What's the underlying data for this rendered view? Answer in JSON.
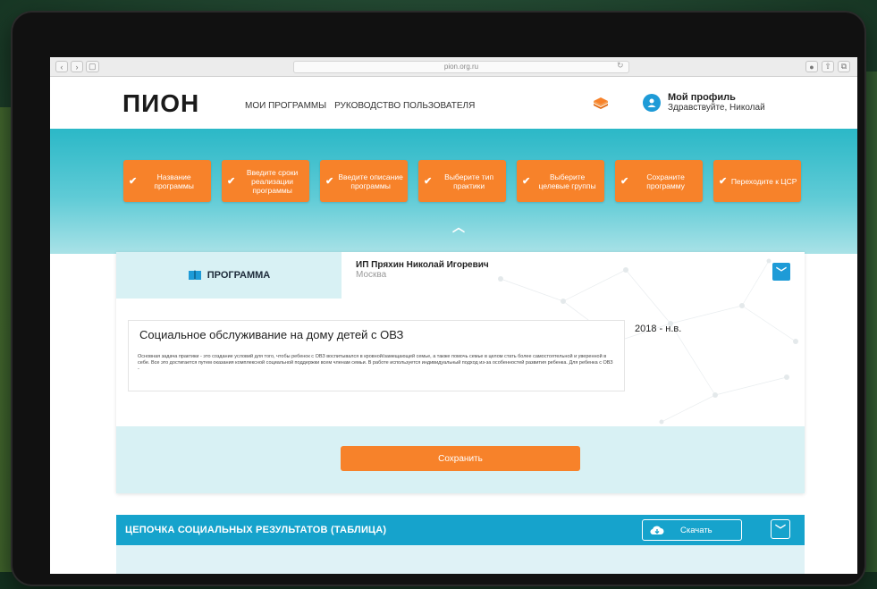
{
  "browser": {
    "url": "pion.org.ru",
    "nav_back": "‹",
    "nav_forward": "›",
    "sidebar_btn": "▢",
    "reload": "↻"
  },
  "header": {
    "logo": "ПИОН",
    "nav": [
      "МОИ ПРОГРАММЫ",
      "РУКОВОДСТВО ПОЛЬЗОВАТЕЛЯ"
    ],
    "profile_title": "Мой профиль",
    "profile_greeting": "Здравствуйте, Николай"
  },
  "steps": [
    {
      "label": "Название программы"
    },
    {
      "label": "Введите сроки реализации программы"
    },
    {
      "label": "Введите описание программы"
    },
    {
      "label": "Выберите тип практики"
    },
    {
      "label": "Выберите целевые группы"
    },
    {
      "label": "Сохраните программу"
    },
    {
      "label": "Переходите к ЦСР"
    }
  ],
  "program": {
    "tab_title": "ПРОГРАММА",
    "owner_name": "ИП Пряхин Николай Игоревич",
    "owner_city": "Москва",
    "heading": "Социальное обслуживание на дому детей с ОВЗ",
    "description": "Основная задача практики - это создание условий для того, чтобы ребенок с ОВЗ воспитывался в кровной/замещающей семье, а также помочь семье в целом стать более самостоятельной и уверенной в себе. Все это достигается путем оказания комплексной социальной поддержки всем членам семьи. В работе используется индивидуальный подход из-за особенностей развития ребенка. Для ребенка с ОВЗ -",
    "period": "2018 - н.в.",
    "save_label": "Сохранить"
  },
  "chain": {
    "title": "ЦЕПОЧКА СОЦИАЛЬНЫХ РЕЗУЛЬТАТОВ (ТАБЛИЦА)",
    "download_label": "Скачать"
  },
  "colors": {
    "accent_orange": "#f7822a",
    "accent_blue": "#1e9bd7",
    "teal": "#2bb8c7"
  }
}
